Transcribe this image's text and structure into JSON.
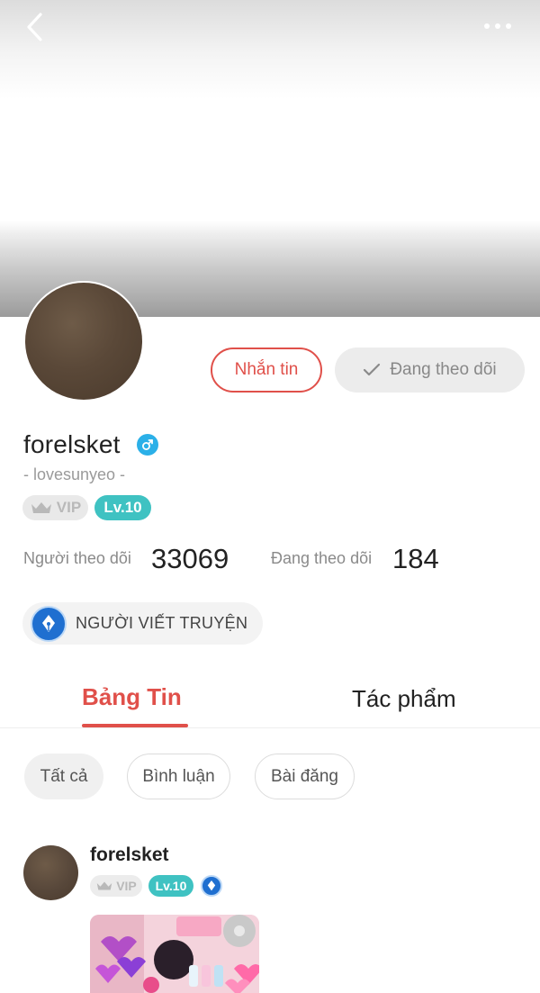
{
  "header": {
    "back_icon": "chevron-left-icon",
    "more_icon": "more-dots-icon"
  },
  "profile": {
    "username": "forelsket",
    "gender_icon": "male-icon",
    "tagline": "- lovesunyeo -",
    "vip_label": "VIP",
    "level_label": "Lv.10",
    "message_button": "Nhắn tin",
    "following_button": "Đang theo dõi",
    "followers_label": "Người theo dõi",
    "followers_count": "33069",
    "following_label": "Đang theo dõi",
    "following_count": "184",
    "role_label": "NGƯỜI VIẾT TRUYỆN"
  },
  "tabs": [
    {
      "label": "Bảng Tin",
      "active": true
    },
    {
      "label": "Tác phẩm",
      "active": false
    }
  ],
  "filters": [
    {
      "label": "Tất cả",
      "active": true
    },
    {
      "label": "Bình luận",
      "active": false
    },
    {
      "label": "Bài đăng",
      "active": false
    }
  ],
  "post": {
    "author": "forelsket",
    "vip_label": "VIP",
    "level_label": "Lv.10"
  },
  "colors": {
    "accent": "#e0504a",
    "level_badge": "#3fc2c2",
    "gender": "#2bb0e8",
    "role_icon": "#1f6fd0"
  }
}
